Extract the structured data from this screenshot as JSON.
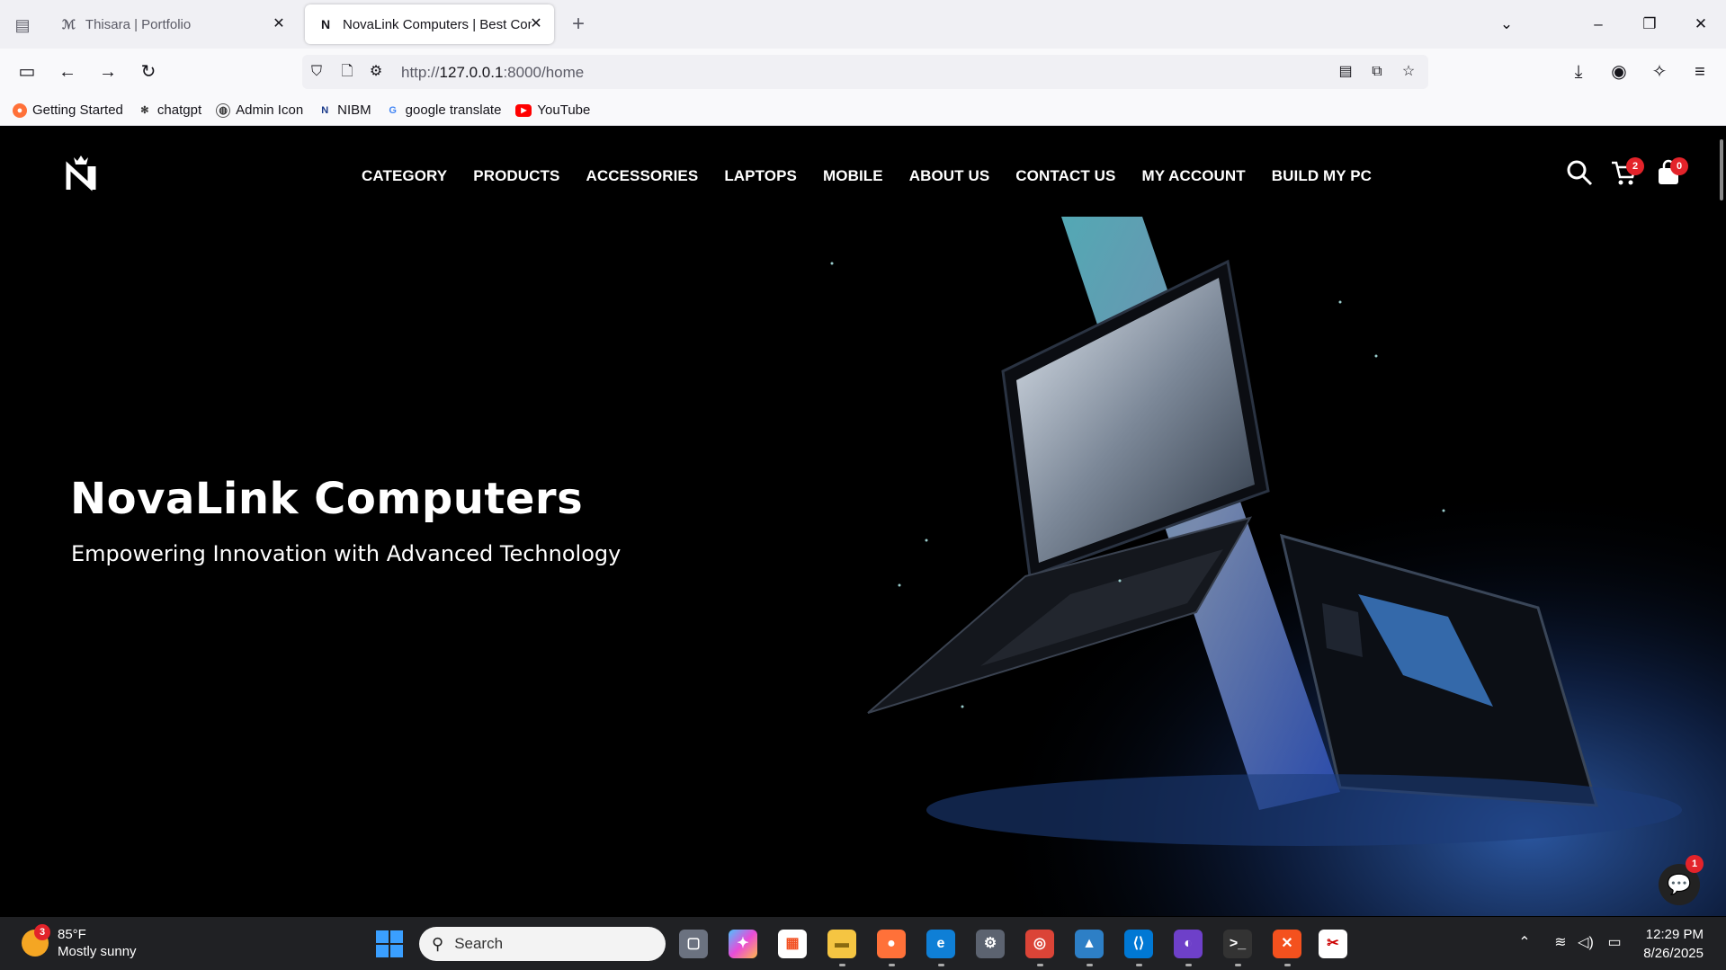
{
  "browser": {
    "tabs": [
      {
        "title": "Thisara | Portfolio",
        "favicon": "portfolio-favicon",
        "active": false
      },
      {
        "title": "NovaLink Computers | Best Computer Store",
        "favicon": "novalink-favicon",
        "active": true
      }
    ],
    "url": {
      "scheme": "http://",
      "host": "127.0.0.1",
      "rest": ":8000/home"
    },
    "bookmarks": [
      {
        "label": "Getting Started",
        "icon": "firefox-icon"
      },
      {
        "label": "chatgpt",
        "icon": "openai-icon"
      },
      {
        "label": "Admin Icon",
        "icon": "globe-icon"
      },
      {
        "label": "NIBM",
        "icon": "nibm-icon"
      },
      {
        "label": "google translate",
        "icon": "google-icon"
      },
      {
        "label": "YouTube",
        "icon": "youtube-icon"
      }
    ]
  },
  "site": {
    "nav": [
      "CATEGORY",
      "PRODUCTS",
      "ACCESSORIES",
      "LAPTOPS",
      "MOBILE",
      "ABOUT US",
      "CONTACT US",
      "MY ACCOUNT",
      "BUILD MY PC"
    ],
    "cart_count": "2",
    "bag_count": "0",
    "hero_title": "NovaLink Computers",
    "hero_subtitle": "Empowering Innovation with Advanced Technology",
    "chat_badge": "1"
  },
  "taskbar": {
    "weather_temp": "85°F",
    "weather_desc": "Mostly sunny",
    "weather_badge": "3",
    "search_placeholder": "Search",
    "time": "12:29 PM",
    "date": "8/26/2025",
    "accent": "#e3232a"
  }
}
